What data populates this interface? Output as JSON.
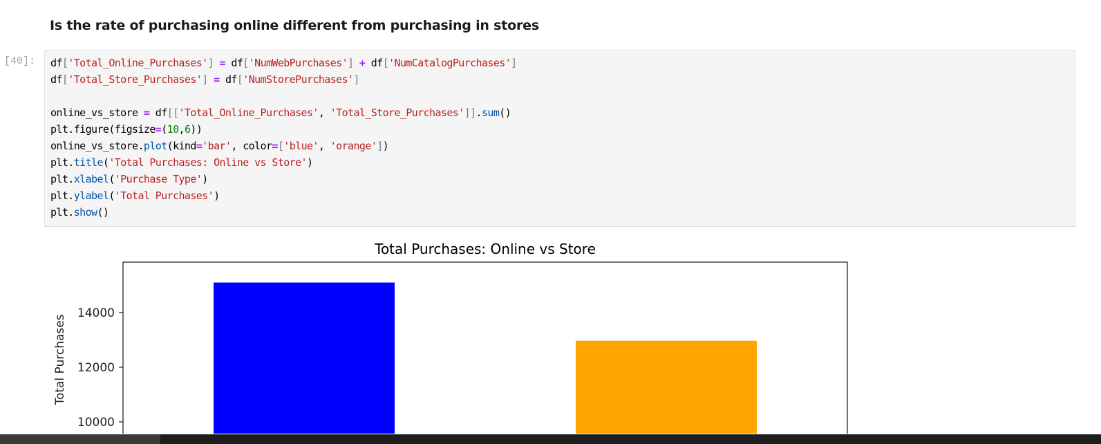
{
  "notebook": {
    "markdown_heading": "Is the rate of purchasing online different from purchasing in stores",
    "cell": {
      "prompt": "[40]:",
      "code_lines": [
        [
          [
            "df",
            "id"
          ],
          [
            "[",
            "br"
          ],
          [
            "'Total_Online_Purchases'",
            "str"
          ],
          [
            "]",
            "br"
          ],
          [
            " ",
            "id"
          ],
          [
            "=",
            "op"
          ],
          [
            " df",
            "id"
          ],
          [
            "[",
            "br"
          ],
          [
            "'NumWebPurchases'",
            "str"
          ],
          [
            "]",
            "br"
          ],
          [
            " ",
            "id"
          ],
          [
            "+",
            "op"
          ],
          [
            " df",
            "id"
          ],
          [
            "[",
            "br"
          ],
          [
            "'NumCatalogPurchases'",
            "str"
          ],
          [
            "]",
            "br"
          ]
        ],
        [
          [
            "df",
            "id"
          ],
          [
            "[",
            "br"
          ],
          [
            "'Total_Store_Purchases'",
            "str"
          ],
          [
            "]",
            "br"
          ],
          [
            " ",
            "id"
          ],
          [
            "=",
            "op"
          ],
          [
            " df",
            "id"
          ],
          [
            "[",
            "br"
          ],
          [
            "'NumStorePurchases'",
            "str"
          ],
          [
            "]",
            "br"
          ]
        ],
        [],
        [
          [
            "online_vs_store ",
            "id"
          ],
          [
            "=",
            "op"
          ],
          [
            " df",
            "id"
          ],
          [
            "[[",
            "br"
          ],
          [
            "'Total_Online_Purchases'",
            "str"
          ],
          [
            ", ",
            "id"
          ],
          [
            "'Total_Store_Purchases'",
            "str"
          ],
          [
            "]]",
            "br"
          ],
          [
            ".",
            "id"
          ],
          [
            "sum",
            "fn"
          ],
          [
            "()",
            "id"
          ]
        ],
        [
          [
            "plt",
            "id"
          ],
          [
            ".",
            "id"
          ],
          [
            "figure",
            "id"
          ],
          [
            "(figsize",
            "id"
          ],
          [
            "=",
            "op"
          ],
          [
            "(",
            "id"
          ],
          [
            "10",
            "num"
          ],
          [
            ",",
            "id"
          ],
          [
            "6",
            "num"
          ],
          [
            "))",
            "id"
          ]
        ],
        [
          [
            "online_vs_store",
            "id"
          ],
          [
            ".",
            "id"
          ],
          [
            "plot",
            "fn"
          ],
          [
            "(kind",
            "id"
          ],
          [
            "=",
            "op"
          ],
          [
            "'bar'",
            "str"
          ],
          [
            ", color",
            "id"
          ],
          [
            "=",
            "op"
          ],
          [
            "[",
            "br"
          ],
          [
            "'blue'",
            "str"
          ],
          [
            ", ",
            "id"
          ],
          [
            "'orange'",
            "str"
          ],
          [
            "]",
            "br"
          ],
          [
            ")",
            "id"
          ]
        ],
        [
          [
            "plt",
            "id"
          ],
          [
            ".",
            "id"
          ],
          [
            "title",
            "fn"
          ],
          [
            "(",
            "id"
          ],
          [
            "'Total Purchases: Online vs Store'",
            "str"
          ],
          [
            ")",
            "id"
          ]
        ],
        [
          [
            "plt",
            "id"
          ],
          [
            ".",
            "id"
          ],
          [
            "xlabel",
            "fn"
          ],
          [
            "(",
            "id"
          ],
          [
            "'Purchase Type'",
            "str"
          ],
          [
            ")",
            "id"
          ]
        ],
        [
          [
            "plt",
            "id"
          ],
          [
            ".",
            "id"
          ],
          [
            "ylabel",
            "fn"
          ],
          [
            "(",
            "id"
          ],
          [
            "'Total Purchases'",
            "str"
          ],
          [
            ")",
            "id"
          ]
        ],
        [
          [
            "plt",
            "id"
          ],
          [
            ".",
            "id"
          ],
          [
            "show",
            "fn"
          ],
          [
            "()",
            "id"
          ]
        ]
      ]
    }
  },
  "chart_data": {
    "type": "bar",
    "title": "Total Purchases: Online vs Store",
    "ylabel": "Total Purchases",
    "values": [
      15100,
      12970
    ],
    "colors": [
      "#0000ff",
      "#ffa500"
    ],
    "yticks": [
      "14000",
      "12000",
      "10000"
    ],
    "ylim": [
      0,
      15850
    ],
    "grid": false
  }
}
